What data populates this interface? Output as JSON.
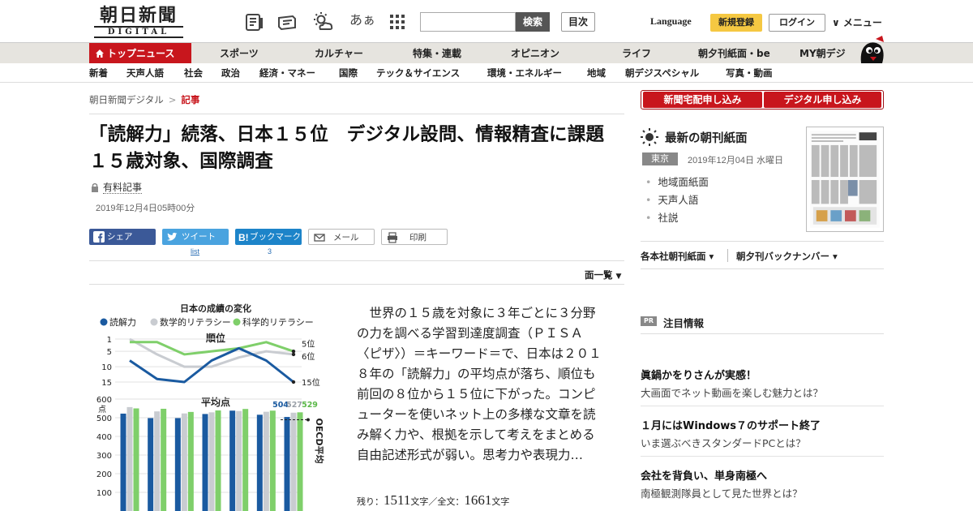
{
  "header": {
    "logo_jp": "朝日新聞",
    "logo_en": "DIGITAL",
    "aa_label": "あぁ",
    "search_placeholder": "",
    "search_button": "検索",
    "mokuji": "目次",
    "language": "Language",
    "register": "新規登録",
    "login": "ログイン",
    "menu": "∨ メニュー"
  },
  "nav1": {
    "top": "トップニュース",
    "items": [
      "スポーツ",
      "カルチャー",
      "特集・連載",
      "オピニオン",
      "ライフ",
      "朝夕刊紙面・be",
      "MY朝デジ"
    ]
  },
  "nav2": {
    "items": [
      "新着",
      "天声人語",
      "社会",
      "政治",
      "経済・マネー",
      "国際",
      "テック＆サイエンス",
      "環境・エネルギー",
      "地域",
      "朝デジスペシャル",
      "写真・動画"
    ]
  },
  "breadcrumb": {
    "home": "朝日新聞デジタル",
    "sep": ">",
    "current": "記事"
  },
  "article": {
    "headline": "「読解力」続落、日本１５位　デジタル設問、情報精査に課題　１５歳対象、国際調査",
    "paid": "有料記事",
    "date": "2019年12月4日05時00分",
    "body": "世界の１５歳を対象に３年ごとに３分野の力を調べる学習到達度調査（ＰＩＳＡ〈ピザ〉）＝キーワード＝で、日本は２０１８年の「読解力」の平均点が落ち、順位も前回の８位から１５位に下がった。コンピューターを使いネット上の多様な文章を読み解く力や、根拠を示して考えをまとめる自由記述形式が弱い。思考力や表現力…",
    "remain_label": "残り：",
    "remain_num": "1511",
    "remain_unit": "文字／全文：",
    "total_num": "1661",
    "total_unit": "文字",
    "menlist": "面一覧"
  },
  "social": {
    "share": "シェア",
    "tweet": "ツイート",
    "bookmark": "ブックマーク",
    "mail": "メール",
    "print": "印刷",
    "tweet_count": "list",
    "bookmark_count": "3"
  },
  "chart_data": {
    "type": "line",
    "title": "日本の成績の変化",
    "series_names": [
      "読解力",
      "数学的リテラシー",
      "科学的リテラシー"
    ],
    "colors": {
      "reading": "#1a5aa0",
      "math": "#c9ccd1",
      "science": "#7fcf6a"
    },
    "rank_title": "順位",
    "rank_ylim": [
      1,
      15
    ],
    "rank_ticks": [
      "1",
      "5",
      "10",
      "15"
    ],
    "rank": {
      "reading": [
        8,
        14,
        15,
        8,
        4,
        8,
        15
      ],
      "math": [
        1,
        6,
        10,
        10,
        7,
        5,
        6
      ],
      "science": [
        2,
        2,
        6,
        5,
        4,
        2,
        5
      ]
    },
    "rank_end_labels": [
      "5位",
      "6位",
      "15位"
    ],
    "score_title": "平均点",
    "score_unit": "点",
    "score_ylim": [
      0,
      600
    ],
    "score_ticks": [
      "600",
      "500",
      "400",
      "300",
      "200",
      "100"
    ],
    "score": {
      "reading": [
        522,
        498,
        498,
        520,
        538,
        516,
        504
      ],
      "math": [
        557,
        534,
        523,
        529,
        536,
        532,
        527
      ],
      "science": [
        550,
        548,
        531,
        539,
        547,
        538,
        529
      ]
    },
    "score_end_labels": [
      "504",
      "527",
      "529"
    ],
    "oecd_label": "OECD平均"
  },
  "sidebar": {
    "sub1": "新聞宅配申し込み",
    "sub2": "デジタル申し込み",
    "latest_title": "最新の朝刊紙面",
    "tokyo": "東京",
    "paper_date": "2019年12月04日 水曜日",
    "links": [
      "地域面紙面",
      "天声人語",
      "社説"
    ],
    "edition1": "各本社朝刊紙面 ▾",
    "edition2": "朝夕刊バックナンバー ▾",
    "pr": "PR",
    "pr_title": "注目情報",
    "pr_items": [
      {
        "head": "眞鍋かをりさんが実感！",
        "sub": "大画面でネット動画を楽しむ魅力とは？"
      },
      {
        "head": "１月にはWindows７のサポート終了",
        "sub": "いま選ぶべきスタンダードPCとは？"
      },
      {
        "head": "会社を背負い、単身南極へ",
        "sub": "南極観測隊員として見た世界とは？"
      }
    ]
  }
}
